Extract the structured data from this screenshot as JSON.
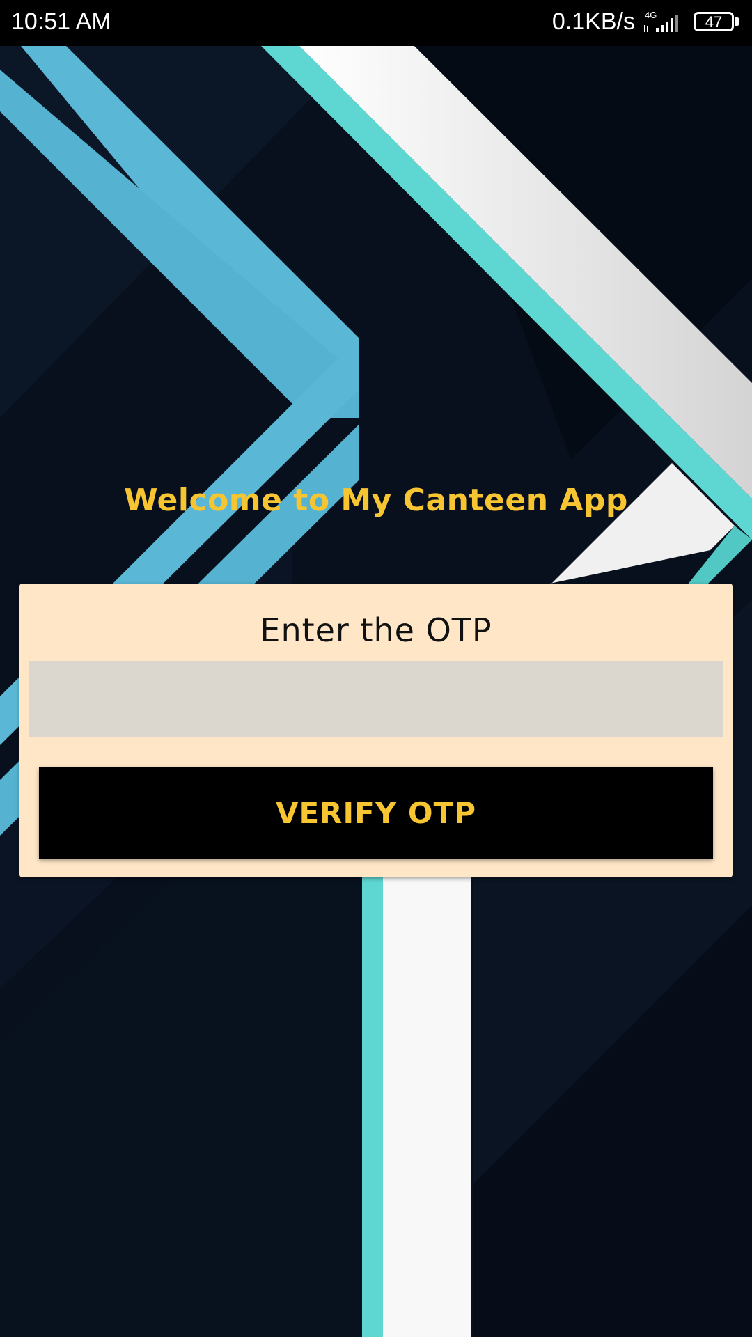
{
  "status_bar": {
    "time": "10:51 AM",
    "network_speed": "0.1KB/s",
    "network_type": "4G",
    "battery_level": "47",
    "icons": [
      "signal-icon",
      "battery-icon"
    ]
  },
  "welcome": {
    "title": "Welcome to My Canteen App"
  },
  "otp_card": {
    "heading": "Enter the OTP",
    "input_value": "",
    "input_placeholder": "",
    "verify_label": "VERIFY OTP"
  },
  "colors": {
    "accent_yellow": "#f7c531",
    "card_background": "#fee6c6",
    "input_background": "#dbd6ce",
    "button_background": "#000000",
    "stripe_blue": "#5ab8d6",
    "stripe_teal": "#5ed6d2",
    "stripe_white": "#f8f8f8",
    "background_dark": "#07101c"
  }
}
